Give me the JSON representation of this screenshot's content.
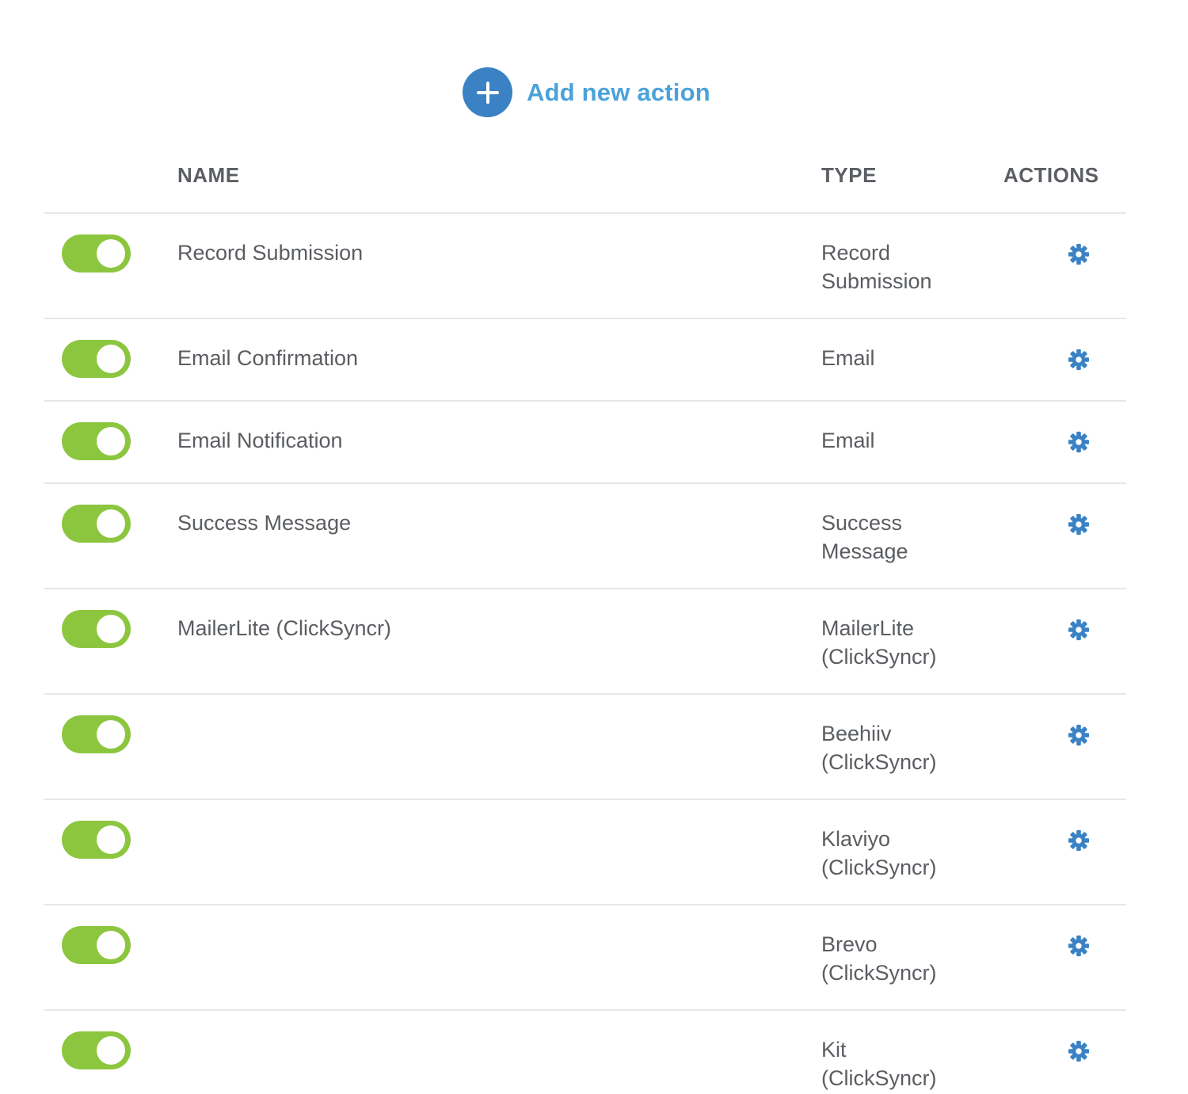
{
  "add_action": {
    "label": "Add new action",
    "icon": "plus-circle-icon"
  },
  "table": {
    "headers": {
      "name": "NAME",
      "type": "TYPE",
      "actions": "ACTIONS"
    },
    "rows": [
      {
        "enabled": true,
        "name": "Record Submission",
        "type_lines": [
          "Record",
          "Submission"
        ]
      },
      {
        "enabled": true,
        "name": "Email Confirmation",
        "type_lines": [
          "Email"
        ]
      },
      {
        "enabled": true,
        "name": "Email Notification",
        "type_lines": [
          "Email"
        ]
      },
      {
        "enabled": true,
        "name": "Success Message",
        "type_lines": [
          "Success",
          "Message"
        ]
      },
      {
        "enabled": true,
        "name": "MailerLite (ClickSyncr)",
        "type_lines": [
          "MailerLite",
          "(ClickSyncr)"
        ]
      },
      {
        "enabled": true,
        "name": "",
        "type_lines": [
          "Beehiiv",
          "(ClickSyncr)"
        ]
      },
      {
        "enabled": true,
        "name": "",
        "type_lines": [
          "Klaviyo",
          "(ClickSyncr)"
        ]
      },
      {
        "enabled": true,
        "name": "",
        "type_lines": [
          "Brevo",
          "(ClickSyncr)"
        ]
      },
      {
        "enabled": true,
        "name": "",
        "type_lines": [
          "Kit",
          "(ClickSyncr)"
        ]
      }
    ]
  },
  "colors": {
    "toggle_on": "#8cc63f",
    "accent": "#3b82c4",
    "link": "#4aa2d9",
    "text": "#5a5d61",
    "divider": "#e6e7e8"
  },
  "icons": {
    "settings": "gear-icon",
    "add": "plus-circle-icon"
  }
}
